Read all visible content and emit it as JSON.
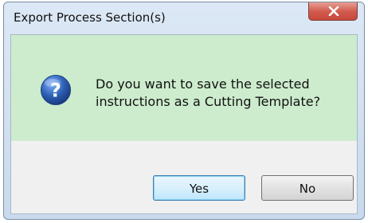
{
  "window": {
    "title": "Export Process Section(s)",
    "close_icon": "close-x-icon"
  },
  "message": {
    "icon": "question-icon",
    "text": "Do you want to save the selected instructions as a Cutting Template?"
  },
  "buttons": {
    "yes_label": "Yes",
    "no_label": "No"
  },
  "colors": {
    "message_background": "#cdeccd",
    "button_area_background": "#f0f0f0",
    "close_button": "#d15a4c",
    "question_icon": "#2d5fb3"
  }
}
